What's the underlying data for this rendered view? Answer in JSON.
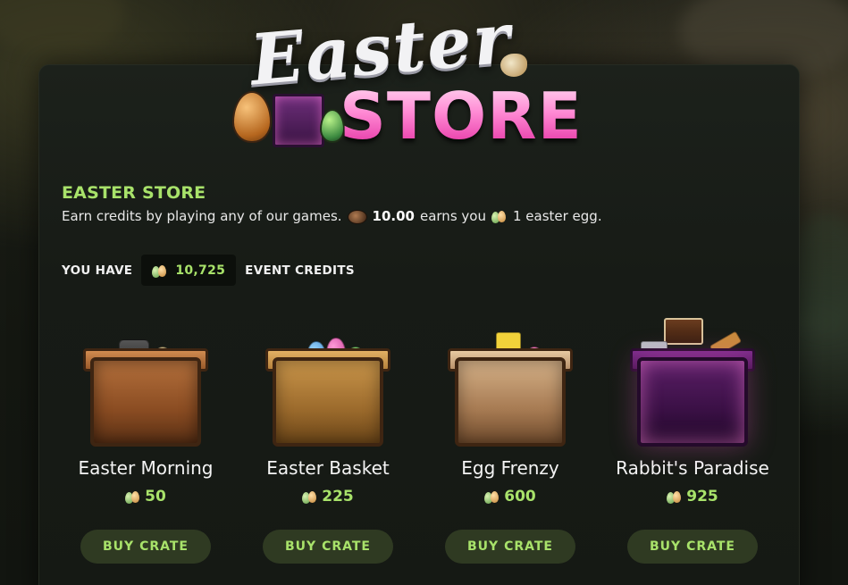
{
  "logo": {
    "script_text": "Easter",
    "store_text": "STORE"
  },
  "header": {
    "title": "EASTER STORE",
    "desc_prefix": "Earn credits by playing any of our games.",
    "desc_amount": "10.00",
    "desc_middle": "earns you",
    "desc_suffix": "1 easter egg."
  },
  "balance": {
    "label": "YOU HAVE",
    "value": "10,725",
    "suffix": "EVENT CREDITS"
  },
  "crates": [
    {
      "name": "Easter Morning",
      "price": "50",
      "button": "BUY CRATE",
      "style": "wood"
    },
    {
      "name": "Easter Basket",
      "price": "225",
      "button": "BUY CRATE",
      "style": "basket"
    },
    {
      "name": "Egg Frenzy",
      "price": "600",
      "button": "BUY CRATE",
      "style": "frenzy"
    },
    {
      "name": "Rabbit's Paradise",
      "price": "925",
      "button": "BUY CRATE",
      "style": "paradise"
    }
  ],
  "icons": {
    "coin": "coin-icon",
    "egg": "egg-credit-icon"
  },
  "colors": {
    "accent_green": "#a8e26a",
    "button_bg": "#2f3a22",
    "panel_bg": "#171b16",
    "store_pink": "#ff5fc2"
  }
}
